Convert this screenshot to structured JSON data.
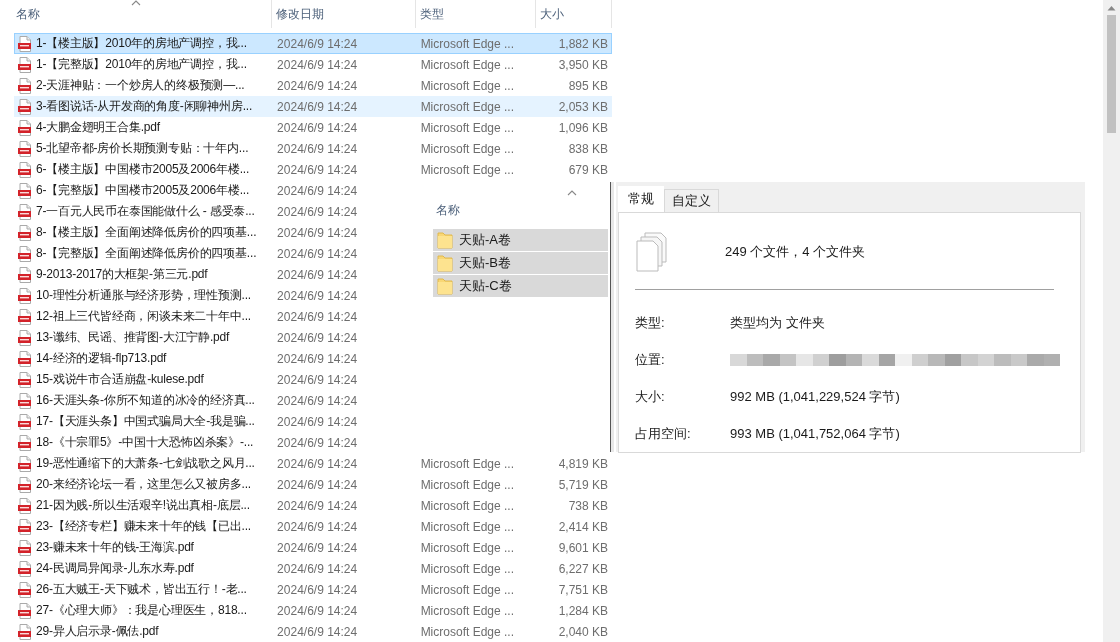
{
  "columns": [
    {
      "label": "名称",
      "sorted": true
    },
    {
      "label": "修改日期",
      "sorted": false
    },
    {
      "label": "类型",
      "sorted": false
    },
    {
      "label": "大小",
      "sorted": false
    }
  ],
  "files": [
    {
      "name": "1-【楼主版】2010年的房地产调控，我...",
      "date": "2024/6/9 14:24",
      "type": "Microsoft Edge ...",
      "size": "1,882 KB",
      "selected": true,
      "hovered": false
    },
    {
      "name": "1-【完整版】2010年的房地产调控，我...",
      "date": "2024/6/9 14:24",
      "type": "Microsoft Edge ...",
      "size": "3,950 KB",
      "selected": false,
      "hovered": false
    },
    {
      "name": "2-天涯神贴：一个炒房人的终极预测—...",
      "date": "2024/6/9 14:24",
      "type": "Microsoft Edge ...",
      "size": "895 KB",
      "selected": false,
      "hovered": false
    },
    {
      "name": "3-看图说话-从开发商的角度-闲聊神州房...",
      "date": "2024/6/9 14:24",
      "type": "Microsoft Edge ...",
      "size": "2,053 KB",
      "selected": false,
      "hovered": true
    },
    {
      "name": "4-大鹏金翅明王合集.pdf",
      "date": "2024/6/9 14:24",
      "type": "Microsoft Edge ...",
      "size": "1,096 KB",
      "selected": false,
      "hovered": false
    },
    {
      "name": "5-北望帝都-房价长期预测专贴：十年内...",
      "date": "2024/6/9 14:24",
      "type": "Microsoft Edge ...",
      "size": "838 KB",
      "selected": false,
      "hovered": false
    },
    {
      "name": "6-【楼主版】中国楼市2005及2006年楼...",
      "date": "2024/6/9 14:24",
      "type": "Microsoft Edge ...",
      "size": "679 KB",
      "selected": false,
      "hovered": false
    },
    {
      "name": "6-【完整版】中国楼市2005及2006年楼...",
      "date": "2024/6/9 14:24",
      "selected": false,
      "hovered": false
    },
    {
      "name": "7-一百元人民币在泰国能做什么 - 感受泰...",
      "date": "2024/6/9 14:24",
      "selected": false,
      "hovered": false
    },
    {
      "name": "8-【楼主版】全面阐述降低房价的四项基...",
      "date": "2024/6/9 14:24",
      "selected": false,
      "hovered": false
    },
    {
      "name": "8-【完整版】全面阐述降低房价的四项基...",
      "date": "2024/6/9 14:24",
      "selected": false,
      "hovered": false
    },
    {
      "name": "9-2013-2017的大框架-第三元.pdf",
      "date": "2024/6/9 14:24",
      "selected": false,
      "hovered": false
    },
    {
      "name": "10-理性分析通胀与经济形势，理性预测...",
      "date": "2024/6/9 14:24",
      "selected": false,
      "hovered": false
    },
    {
      "name": "12-祖上三代皆经商，闲谈未来二十年中...",
      "date": "2024/6/9 14:24",
      "selected": false,
      "hovered": false
    },
    {
      "name": "13-谶纬、民谣、推背图-大江宁静.pdf",
      "date": "2024/6/9 14:24",
      "selected": false,
      "hovered": false
    },
    {
      "name": "14-经济的逻辑-flp713.pdf",
      "date": "2024/6/9 14:24",
      "selected": false,
      "hovered": false
    },
    {
      "name": "15-戏说牛市合适崩盘-kulese.pdf",
      "date": "2024/6/9 14:24",
      "selected": false,
      "hovered": false
    },
    {
      "name": "16-天涯头条-你所不知道的冰冷的经济真...",
      "date": "2024/6/9 14:24",
      "selected": false,
      "hovered": false
    },
    {
      "name": "17-【天涯头条】中国式骗局大全-我是骗...",
      "date": "2024/6/9 14:24",
      "selected": false,
      "hovered": false
    },
    {
      "name": "18-《十宗罪5》-中国十大恐怖凶杀案》-...",
      "date": "2024/6/9 14:24",
      "selected": false,
      "hovered": false
    },
    {
      "name": "19-恶性通缩下的大萧条-七剑战歌之风月...",
      "date": "2024/6/9 14:24",
      "type": "Microsoft Edge ...",
      "size": "4,819 KB",
      "selected": false,
      "hovered": false
    },
    {
      "name": "20-来经济论坛一看，这里怎么又被房多...",
      "date": "2024/6/9 14:24",
      "type": "Microsoft Edge ...",
      "size": "5,719 KB",
      "selected": false,
      "hovered": false
    },
    {
      "name": "21-因为贱-所以生活艰辛!说出真相-底层...",
      "date": "2024/6/9 14:24",
      "type": "Microsoft Edge ...",
      "size": "738 KB",
      "selected": false,
      "hovered": false
    },
    {
      "name": "23-【经济专栏】赚未来十年的钱【已出...",
      "date": "2024/6/9 14:24",
      "type": "Microsoft Edge ...",
      "size": "2,414 KB",
      "selected": false,
      "hovered": false
    },
    {
      "name": "23-赚未来十年的钱-王海滨.pdf",
      "date": "2024/6/9 14:24",
      "type": "Microsoft Edge ...",
      "size": "9,601 KB",
      "selected": false,
      "hovered": false
    },
    {
      "name": "24-民调局异闻录-儿东水寿.pdf",
      "date": "2024/6/9 14:24",
      "type": "Microsoft Edge ...",
      "size": "6,227 KB",
      "selected": false,
      "hovered": false
    },
    {
      "name": "26-五大贼王-天下贼术，皆出五行！-老...",
      "date": "2024/6/9 14:24",
      "type": "Microsoft Edge ...",
      "size": "7,751 KB",
      "selected": false,
      "hovered": false
    },
    {
      "name": "27-《心理大师》：我是心理医生，818...",
      "date": "2024/6/9 14:24",
      "type": "Microsoft Edge ...",
      "size": "1,284 KB",
      "selected": false,
      "hovered": false
    },
    {
      "name": "29-异人启示录-佩佉.pdf",
      "date": "2024/6/9 14:24",
      "type": "Microsoft Edge ...",
      "size": "2,040 KB",
      "selected": false,
      "hovered": false
    }
  ],
  "overlay": {
    "explorer": {
      "column": {
        "label": "名称",
        "sorted": true
      },
      "folders": [
        {
          "name": "天贴-A卷",
          "selected": true
        },
        {
          "name": "天贴-B卷",
          "selected": true
        },
        {
          "name": "天贴-C卷",
          "selected": true
        }
      ]
    },
    "properties": {
      "tabs": [
        {
          "label": "常规",
          "selected": true
        },
        {
          "label": "自定义",
          "selected": false
        }
      ],
      "summary": "249 个文件，4 个文件夹",
      "fields": [
        {
          "kind": "text",
          "label": "类型:",
          "value": "类型均为 文件夹"
        },
        {
          "kind": "redacted",
          "label": "位置:"
        },
        {
          "kind": "text",
          "label": "大小:",
          "value": "992 MB (1,041,229,524 字节)"
        },
        {
          "kind": "text",
          "label": "占用空间:",
          "value": "993 MB (1,041,752,064 字节)"
        }
      ]
    }
  }
}
